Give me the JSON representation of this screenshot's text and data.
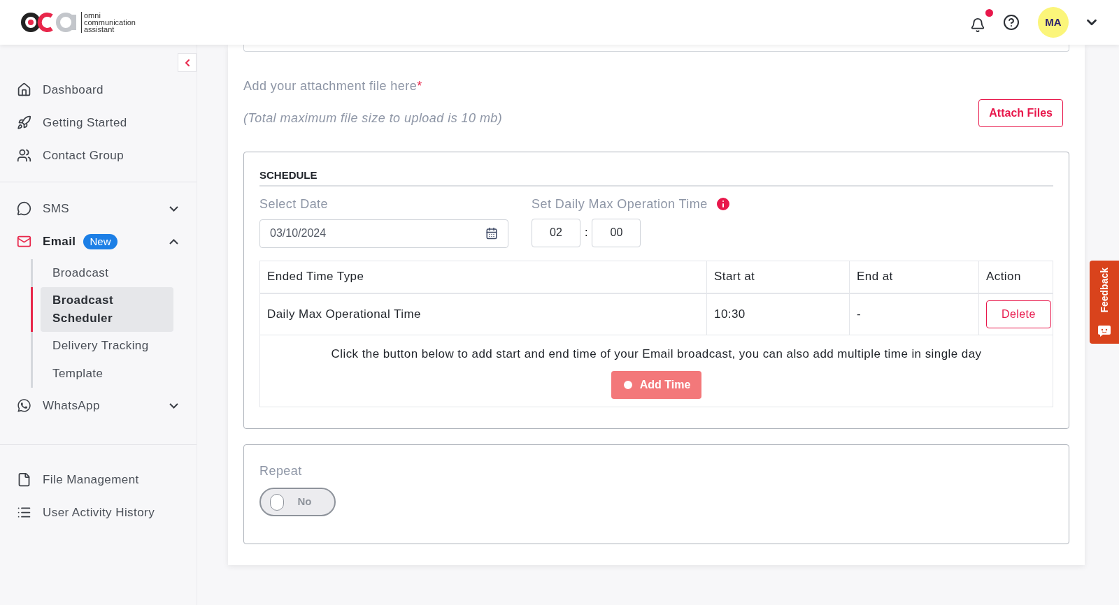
{
  "header": {
    "logo_lines": [
      "omni",
      "communication",
      "assistant"
    ],
    "notification_unread": true,
    "avatar": "MA"
  },
  "sidebar": {
    "groups": [
      {
        "items": [
          {
            "label": "Dashboard"
          },
          {
            "label": "Getting Started"
          },
          {
            "label": "Contact Group"
          }
        ]
      },
      {
        "items": [
          {
            "label": "SMS",
            "expanded": false
          },
          {
            "label": "Email",
            "badge": "New",
            "expanded": true,
            "children": [
              {
                "label": "Broadcast",
                "selected": false
              },
              {
                "label": "Broadcast Scheduler",
                "selected": true
              },
              {
                "label": "Delivery Tracking",
                "selected": false
              },
              {
                "label": "Template",
                "selected": false
              }
            ]
          },
          {
            "label": "WhatsApp",
            "expanded": false
          }
        ]
      },
      {
        "items": [
          {
            "label": "File Management"
          },
          {
            "label": "User Activity History"
          }
        ]
      }
    ]
  },
  "attachment": {
    "label": "Add your attachment file here",
    "required_mark": "*",
    "note": "(Total maximum file size to upload is 10 mb)",
    "button": "Attach Files"
  },
  "schedule": {
    "title": "SCHEDULE",
    "date_label": "Select Date",
    "date_value": "03/10/2024",
    "time_label": "Set Daily Max Operation Time",
    "hour": "02",
    "separator": ":",
    "minute": "00",
    "table": {
      "columns": [
        "Ended Time Type",
        "Start at",
        "End at",
        "Action"
      ],
      "rows": [
        {
          "type": "Daily Max Operational Time",
          "start": "10:30",
          "end": "-",
          "action": "Delete"
        }
      ],
      "hint": "Click the button below to add start and end time of your Email broadcast, you can also add multiple time in single day",
      "add_button": "Add Time"
    }
  },
  "repeat": {
    "label": "Repeat",
    "toggle": {
      "on": false,
      "text": "No"
    }
  },
  "feedback": "Feedback"
}
